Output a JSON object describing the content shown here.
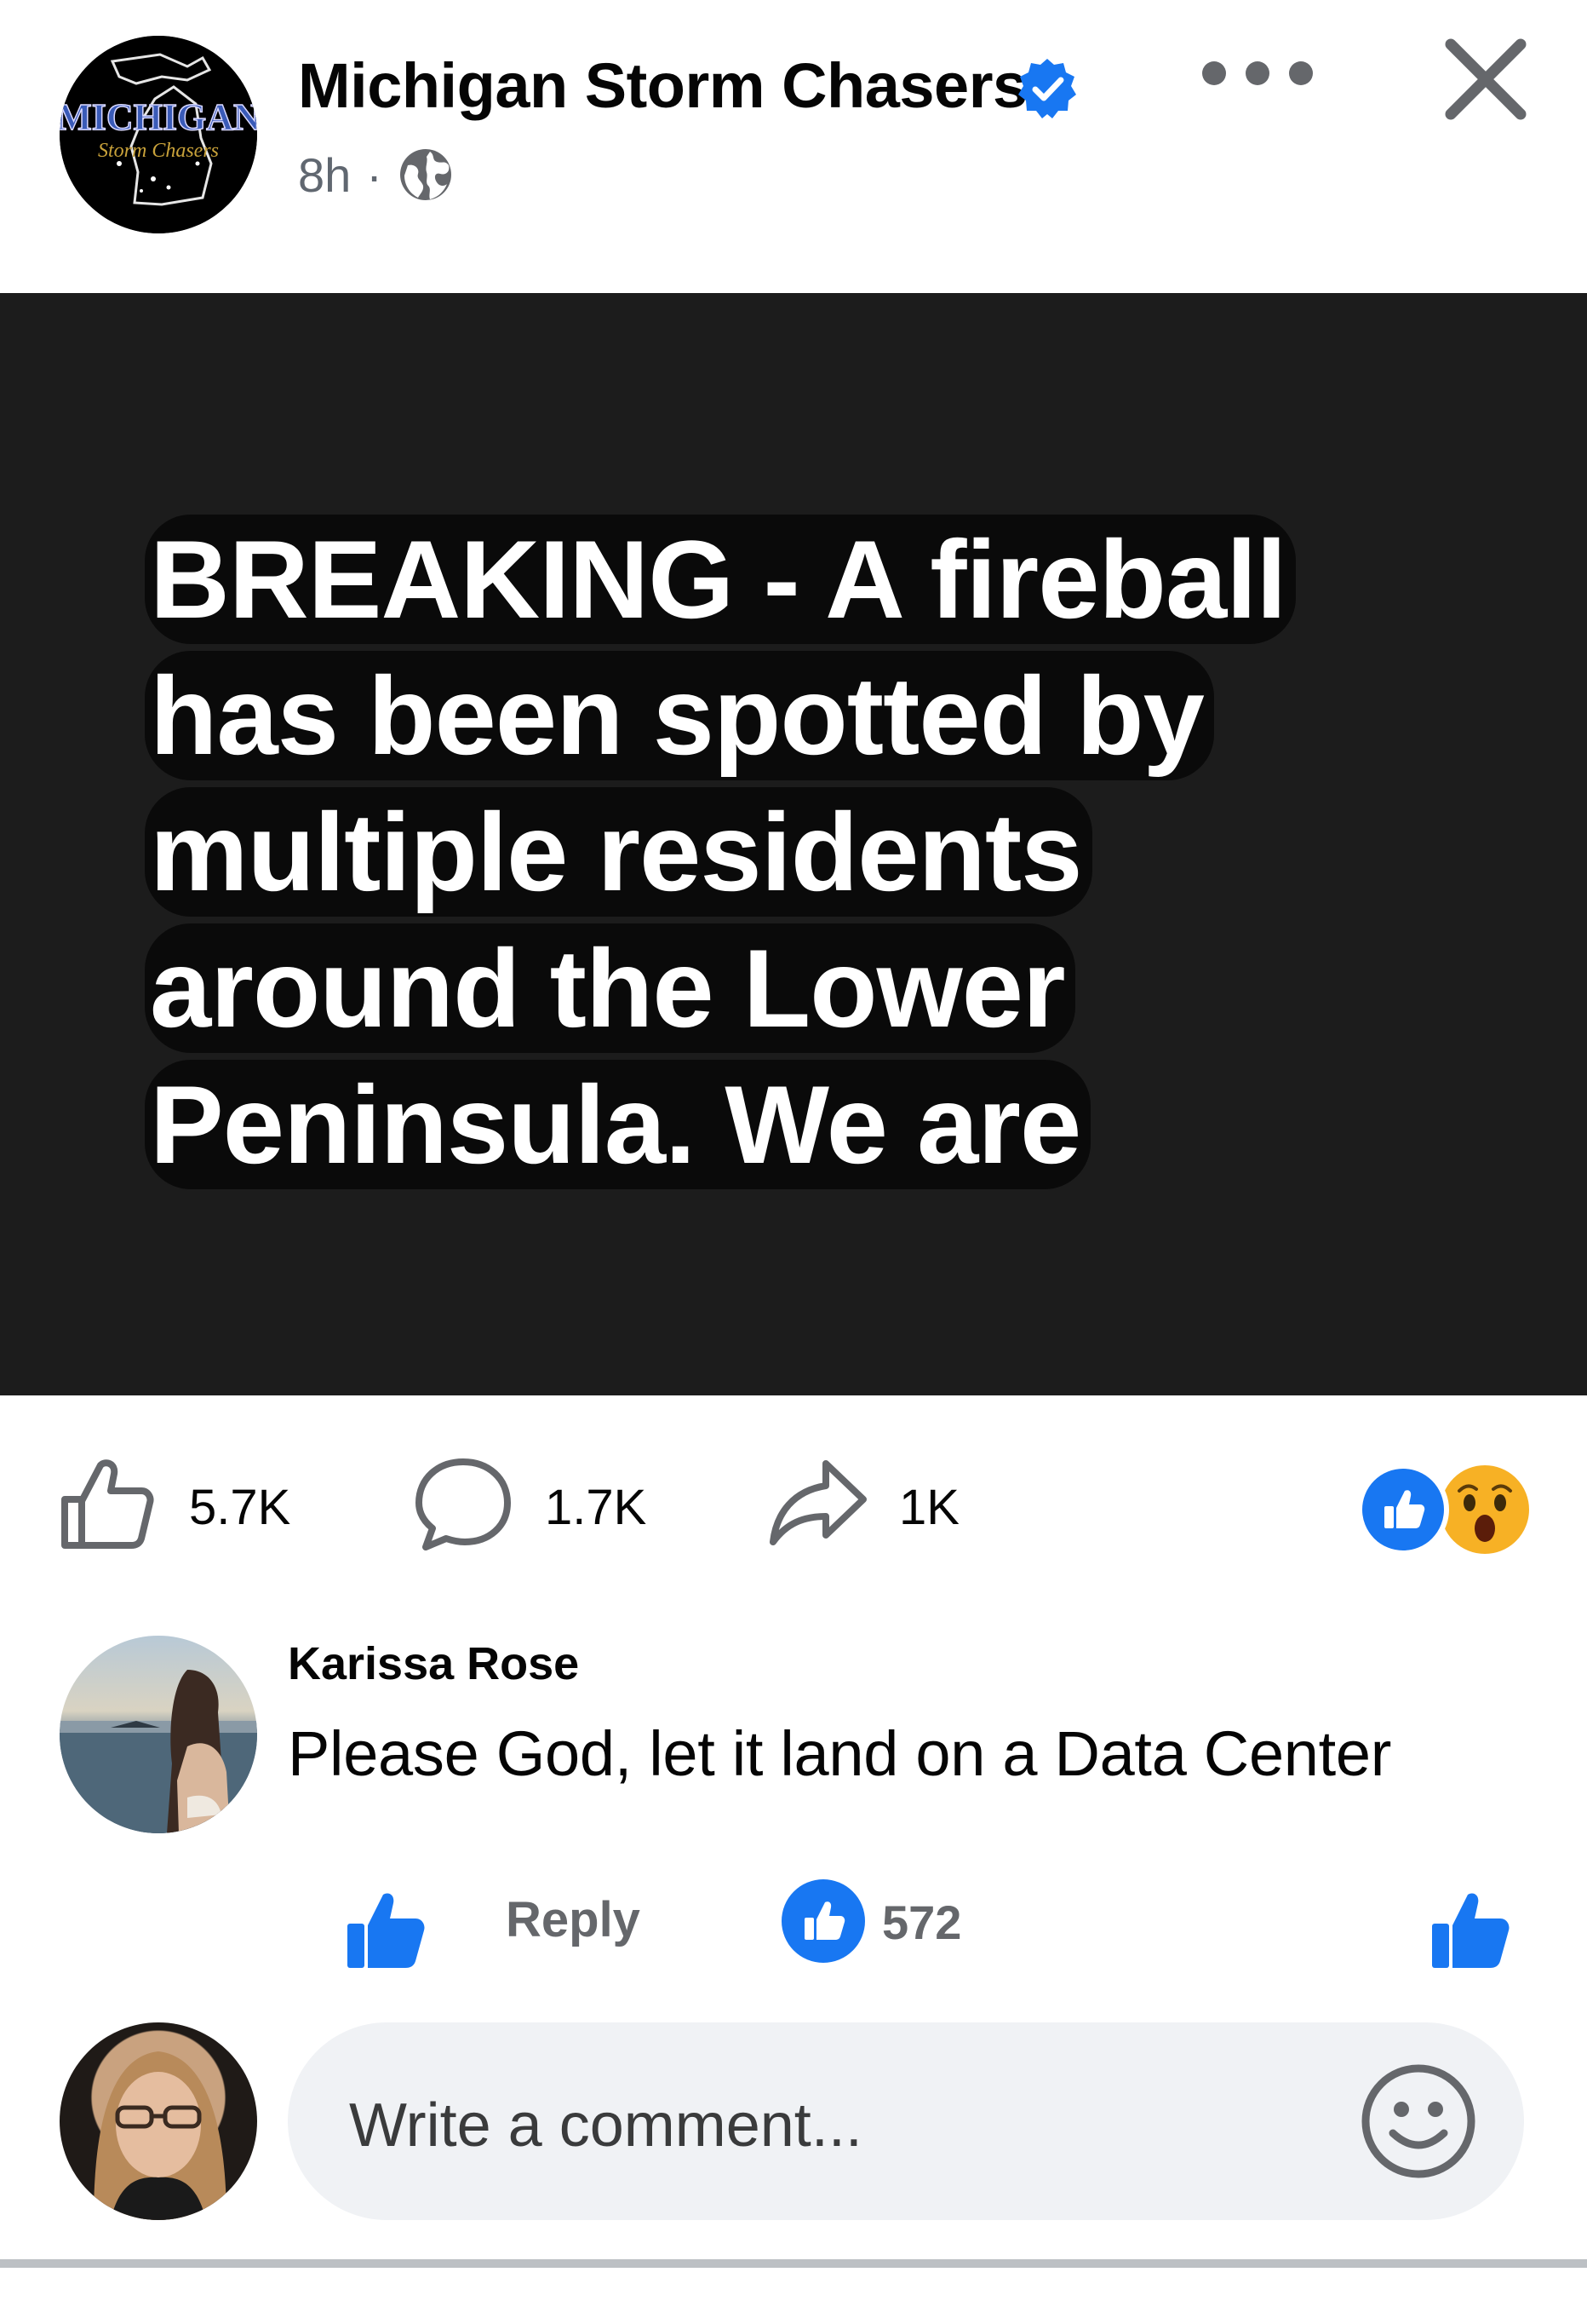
{
  "header": {
    "page_name": "Michigan Storm Chasers",
    "logo_text_top": "MICHIGAN",
    "logo_text_bottom": "Storm Chasers",
    "time": "8h",
    "separator": "·",
    "audience_icon": "globe-icon",
    "verified_icon": "verified-badge-icon",
    "more_icon": "more-options-icon",
    "close_icon": "close-icon"
  },
  "post_image": {
    "background": "#1c1c1c",
    "lines": [
      "BREAKING - A fireball",
      "has been spotted by",
      "multiple residents",
      "around the Lower",
      "Peninsula. We are"
    ]
  },
  "engagement": {
    "likes": "5.7K",
    "comments": "1.7K",
    "shares": "1K",
    "reactions": [
      "like-reaction-icon",
      "wow-reaction-icon"
    ]
  },
  "comment": {
    "author": "Karissa Rose",
    "text": "Please God, let it land on a Data Center",
    "reply_label": "Reply",
    "reaction_count": "572"
  },
  "composer": {
    "placeholder": "Write a comment..."
  },
  "colors": {
    "brand_blue": "#1877f2",
    "muted_text": "#65676b",
    "composer_bg": "#f0f2f5"
  }
}
